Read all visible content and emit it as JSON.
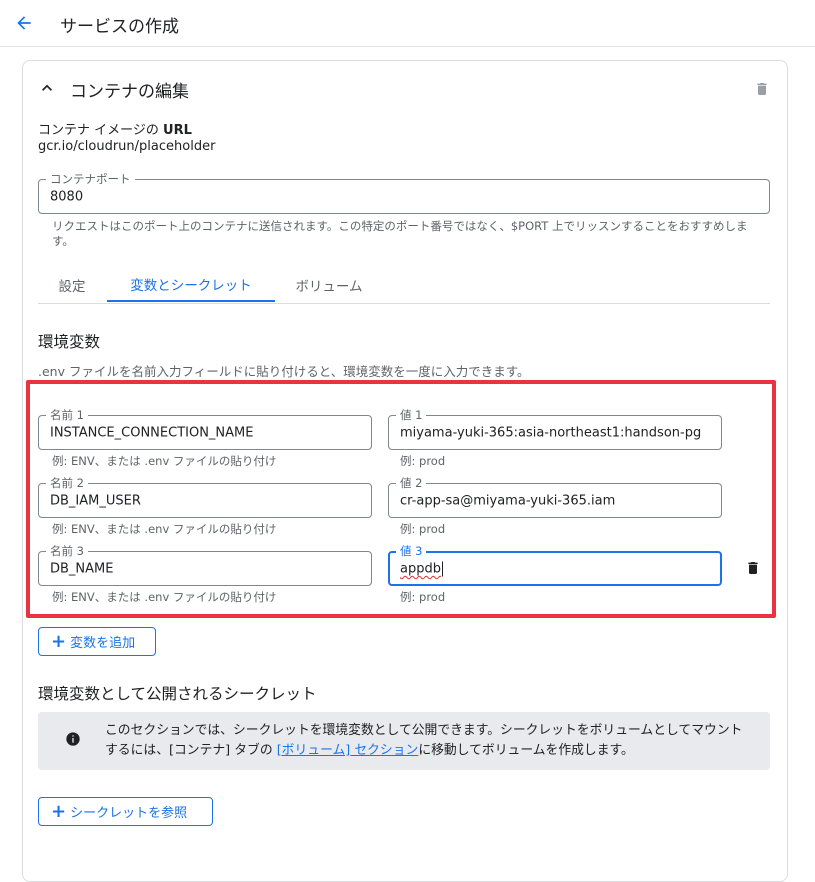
{
  "header": {
    "title": "サービスの作成"
  },
  "container_section": {
    "title": "コンテナの編集",
    "image_url_label_prefix": "コンテナ イメージの ",
    "image_url_label_bold": "URL",
    "image_url_value": "gcr.io/cloudrun/placeholder",
    "port_field": {
      "label": "コンテナポート",
      "value": "8080",
      "helper": "リクエストはこのポート上のコンテナに送信されます。この特定のポート番号ではなく、$PORT 上でリッスンすることをおすすめします。"
    },
    "tabs": [
      {
        "label": "設定",
        "active": false
      },
      {
        "label": "変数とシークレット",
        "active": true
      },
      {
        "label": "ボリューム",
        "active": false
      }
    ]
  },
  "env_vars": {
    "heading": "環境変数",
    "description": ".env ファイルを名前入力フィールドに貼り付けると、環境変数を一度に入力できます。",
    "rows": [
      {
        "name_label": "名前 1",
        "name_value": "INSTANCE_CONNECTION_NAME",
        "name_helper": "例: ENV、または .env ファイルの貼り付け",
        "value_label": "値 1",
        "value_value": "miyama-yuki-365:asia-northeast1:handson-pg",
        "value_helper": "例: prod"
      },
      {
        "name_label": "名前 2",
        "name_value": "DB_IAM_USER",
        "name_helper": "例: ENV、または .env ファイルの貼り付け",
        "value_label": "値 2",
        "value_value": "cr-app-sa@miyama-yuki-365.iam",
        "value_helper": "例: prod"
      },
      {
        "name_label": "名前 3",
        "name_value": "DB_NAME",
        "name_helper": "例: ENV、または .env ファイルの貼り付け",
        "value_label": "値 3",
        "value_value": "appdb",
        "value_helper": "例: prod"
      }
    ],
    "add_button": "変数を追加"
  },
  "secrets": {
    "heading": "環境変数として公開されるシークレット",
    "info_text_1": "このセクションでは、シークレットを環境変数として公開できます。シークレットをボリュームとしてマウントするには、[コンテナ] タブの ",
    "info_link": "[ボリューム] セクション",
    "info_text_2": "に移動してボリュームを作成します。",
    "reference_button": "シークレットを参照"
  },
  "colors": {
    "accent": "#1a73e8",
    "highlight": "#ea3340",
    "info_bg": "#e8eaed"
  },
  "icons": [
    "back-arrow-icon",
    "chevron-up-icon",
    "trash-icon",
    "info-icon",
    "plus-icon"
  ]
}
